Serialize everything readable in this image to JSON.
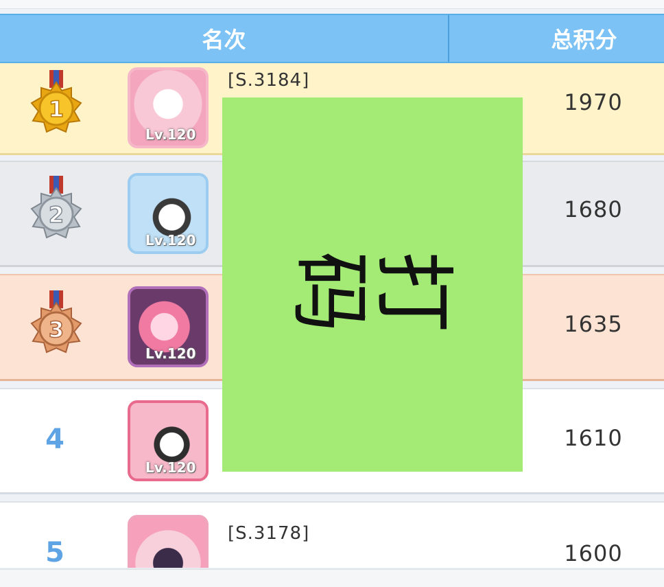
{
  "header": {
    "rank_label": "名次",
    "score_label": "总积分"
  },
  "rows": [
    {
      "rank": "1",
      "medal": "gold-medal-icon",
      "level": "Lv.120",
      "server": "[S.3184]",
      "score": "1970"
    },
    {
      "rank": "2",
      "medal": "silver-medal-icon",
      "level": "Lv.120",
      "server": "",
      "score": "1680"
    },
    {
      "rank": "3",
      "medal": "bronze-medal-icon",
      "level": "Lv.120",
      "server": "",
      "score": "1635"
    },
    {
      "rank": "4",
      "medal": "",
      "level": "Lv.120",
      "server": "",
      "score": "1610"
    },
    {
      "rank": "5",
      "medal": "",
      "level": "",
      "server": "[S.3178]",
      "score": "1600"
    }
  ],
  "overlay": {
    "text": "打码",
    "color": "#a3eb74"
  },
  "colors": {
    "header_bg": "#7cc2f5",
    "gold_row": "#fff3c9",
    "silver_row": "#e9ebee",
    "bronze_row": "#fde3d3",
    "rank_number": "#5ea4e4"
  }
}
